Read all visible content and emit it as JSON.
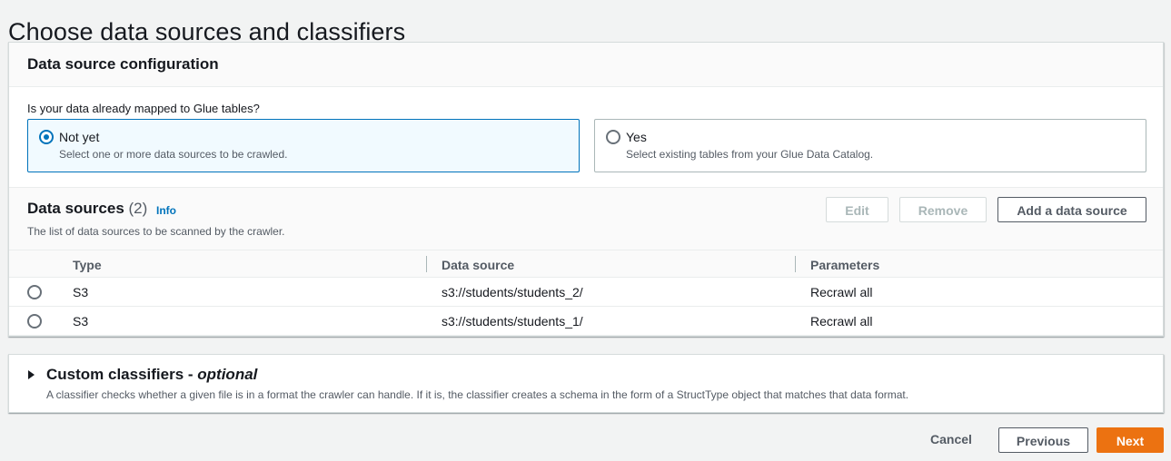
{
  "page": {
    "title": "Choose data sources and classifiers"
  },
  "config_panel": {
    "header": "Data source configuration",
    "question": "Is your data already mapped to Glue tables?",
    "options": [
      {
        "label": "Not yet",
        "description": "Select one or more data sources to be crawled.",
        "selected": true
      },
      {
        "label": "Yes",
        "description": "Select existing tables from your Glue Data Catalog.",
        "selected": false
      }
    ]
  },
  "data_sources": {
    "title": "Data sources",
    "count": "(2)",
    "info_label": "Info",
    "description": "The list of data sources to be scanned by the crawler.",
    "edit_label": "Edit",
    "remove_label": "Remove",
    "add_label": "Add a data source",
    "columns": [
      "Type",
      "Data source",
      "Parameters"
    ],
    "rows": [
      {
        "type": "S3",
        "source": "s3://students/students_2/",
        "parameters": "Recrawl all"
      },
      {
        "type": "S3",
        "source": "s3://students/students_1/",
        "parameters": "Recrawl all"
      }
    ]
  },
  "classifiers": {
    "title": "Custom classifiers - ",
    "optional": "optional",
    "description": "A classifier checks whether a given file is in a format the crawler can handle. If it is, the classifier creates a schema in the form of a StructType object that matches that data format."
  },
  "footer": {
    "cancel_label": "Cancel",
    "previous_label": "Previous",
    "next_label": "Next"
  },
  "colors": {
    "accent": "#0073bb",
    "primary_button": "#ec7211",
    "background": "#f2f3f3"
  },
  "icons": {
    "expand": "caret-right-icon",
    "radio": "radio-icon"
  }
}
